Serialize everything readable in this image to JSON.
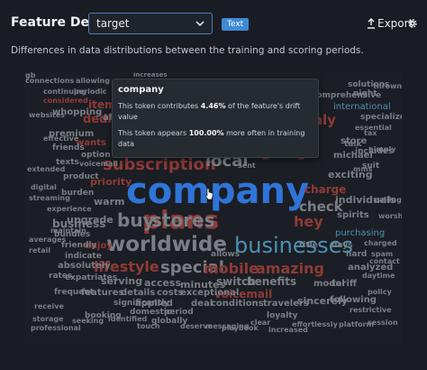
{
  "header": {
    "title": "Feature Details",
    "select_value": "target",
    "type_badge": "Text",
    "export_label": "Export",
    "description": "Differences in data distributions between the training and scoring periods."
  },
  "tooltip": {
    "word": "company",
    "line1_a": "This token contributes ",
    "line1_pct": "4.46%",
    "line1_b": " of the feature's drift value",
    "line2_a": "This token appears ",
    "line2_pct": "100.00%",
    "line2_b": " more often in training data"
  },
  "colors": {
    "accent": "#3f8ad6",
    "blue_word": "#2f74d8",
    "red_word": "#9c3a37",
    "teal_word": "#4c91b3",
    "grey_word": "#7a7f86"
  },
  "icons": {
    "select": "chevron-down-icon",
    "export": "upload-icon",
    "settings": "gear-icon"
  },
  "cloud_words": [
    {
      "t": "company",
      "c": "#2f74d8"
    },
    {
      "t": "plans",
      "c": "#8f3a37"
    },
    {
      "t": "businesses",
      "c": "#4c91b3"
    },
    {
      "t": "worldwide",
      "c": "#7a7f86"
    },
    {
      "t": "buy",
      "c": "#7a7f86"
    },
    {
      "t": "stores",
      "c": "#7a7f86"
    },
    {
      "t": "subscription",
      "c": "#8f3a37"
    },
    {
      "t": "local",
      "c": "#7a7f86"
    },
    {
      "t": "going",
      "c": "#8f3a37"
    },
    {
      "t": "lifestyle",
      "c": "#8f3a37"
    },
    {
      "t": "special",
      "c": "#7a7f86"
    },
    {
      "t": "mobile",
      "c": "#8f3a37"
    },
    {
      "t": "amazing",
      "c": "#8f3a37"
    },
    {
      "t": "hey",
      "c": "#8f3a37"
    },
    {
      "t": "check",
      "c": "#7a7f86"
    },
    {
      "t": "charge",
      "c": "#8f3a37"
    },
    {
      "t": "dedica",
      "c": "#8f3a37"
    },
    {
      "t": "athly",
      "c": "#8f3a37"
    },
    {
      "t": "priority",
      "c": "#8f3a37"
    },
    {
      "t": "warm",
      "c": "#7a7f86"
    },
    {
      "t": "business",
      "c": "#7a7f86"
    },
    {
      "t": "items",
      "c": "#8f3a37"
    },
    {
      "t": "upgrade",
      "c": "#7a7f86"
    },
    {
      "t": "switch",
      "c": "#7a7f86"
    },
    {
      "t": "benefits",
      "c": "#7a7f86"
    },
    {
      "t": "voicemail",
      "c": "#8f3a37"
    },
    {
      "t": "access",
      "c": "#7a7f86"
    },
    {
      "t": "minutes",
      "c": "#7a7f86"
    },
    {
      "t": "absolutely",
      "c": "#7a7f86"
    },
    {
      "t": "serving",
      "c": "#7a7f86"
    },
    {
      "t": "features",
      "c": "#7a7f86"
    },
    {
      "t": "details",
      "c": "#7a7f86"
    },
    {
      "t": "costs",
      "c": "#7a7f86"
    },
    {
      "t": "exceptional",
      "c": "#7a7f86"
    },
    {
      "t": "sincerely",
      "c": "#7a7f86"
    },
    {
      "t": "following",
      "c": "#7a7f86"
    },
    {
      "t": "model",
      "c": "#7a7f86"
    },
    {
      "t": "tariff",
      "c": "#7a7f86"
    },
    {
      "t": "purchasing",
      "c": "#4c91b3"
    },
    {
      "t": "analyzed",
      "c": "#7a7f86"
    },
    {
      "t": "store",
      "c": "#7a7f86"
    },
    {
      "t": "international",
      "c": "#4c91b3"
    },
    {
      "t": "exciting",
      "c": "#7a7f86"
    },
    {
      "t": "individuals",
      "c": "#7a7f86"
    },
    {
      "t": "spirits",
      "c": "#7a7f86"
    },
    {
      "t": "whopping",
      "c": "#7a7f86"
    },
    {
      "t": "premium",
      "c": "#7a7f86"
    },
    {
      "t": "affordable",
      "c": "#7a7f86"
    },
    {
      "t": "wants",
      "c": "#8f3a37"
    },
    {
      "t": "travelers",
      "c": "#7a7f86"
    },
    {
      "t": "loyalty",
      "c": "#7a7f86"
    },
    {
      "t": "applied",
      "c": "#7a7f86"
    },
    {
      "t": "deal",
      "c": "#7a7f86"
    },
    {
      "t": "conditions",
      "c": "#7a7f86"
    },
    {
      "t": "domestic",
      "c": "#7a7f86"
    },
    {
      "t": "period",
      "c": "#7a7f86"
    },
    {
      "t": "friends",
      "c": "#7a7f86"
    },
    {
      "t": "texts",
      "c": "#7a7f86"
    },
    {
      "t": "bundles",
      "c": "#7a7f86"
    },
    {
      "t": "enjoy",
      "c": "#8f3a37"
    },
    {
      "t": "friendly",
      "c": "#7a7f86"
    },
    {
      "t": "indicate",
      "c": "#7a7f86"
    },
    {
      "t": "rates",
      "c": "#7a7f86"
    },
    {
      "t": "frequent",
      "c": "#7a7f86"
    },
    {
      "t": "expatriates",
      "c": "#7a7f86"
    },
    {
      "t": "significantly",
      "c": "#7a7f86"
    },
    {
      "t": "booking",
      "c": "#7a7f86"
    },
    {
      "t": "globally",
      "c": "#7a7f86"
    },
    {
      "t": "messaging",
      "c": "#7a7f86"
    },
    {
      "t": "playbook",
      "c": "#7a7f86"
    },
    {
      "t": "effortlessly",
      "c": "#7a7f86"
    },
    {
      "t": "platform",
      "c": "#7a7f86"
    },
    {
      "t": "restrictive",
      "c": "#7a7f86"
    },
    {
      "t": "seeking",
      "c": "#7a7f86"
    },
    {
      "t": "identified",
      "c": "#7a7f86"
    },
    {
      "t": "professional",
      "c": "#7a7f86"
    },
    {
      "t": "touch",
      "c": "#7a7f86"
    },
    {
      "t": "deserve",
      "c": "#7a7f86"
    },
    {
      "t": "clear",
      "c": "#7a7f86"
    },
    {
      "t": "increased",
      "c": "#7a7f86"
    },
    {
      "t": "session",
      "c": "#7a7f86"
    },
    {
      "t": "connections",
      "c": "#7a7f86"
    },
    {
      "t": "continuing",
      "c": "#7a7f86"
    },
    {
      "t": "considered",
      "c": "#8f3a37"
    },
    {
      "t": "websites",
      "c": "#7a7f86"
    },
    {
      "t": "effective",
      "c": "#7a7f86"
    },
    {
      "t": "extended",
      "c": "#7a7f86"
    },
    {
      "t": "voicemail",
      "c": "#7a7f86"
    },
    {
      "t": "digital",
      "c": "#7a7f86"
    },
    {
      "t": "streaming",
      "c": "#7a7f86"
    },
    {
      "t": "experience",
      "c": "#7a7f86"
    },
    {
      "t": "maintain",
      "c": "#7a7f86"
    },
    {
      "t": "averages",
      "c": "#7a7f86"
    },
    {
      "t": "retail",
      "c": "#7a7f86"
    },
    {
      "t": "receive",
      "c": "#7a7f86"
    },
    {
      "t": "storage",
      "c": "#7a7f86"
    },
    {
      "t": "comprehensive",
      "c": "#7a7f86"
    },
    {
      "t": "solutions",
      "c": "#7a7f86"
    },
    {
      "t": "thrown",
      "c": "#7a7f86"
    },
    {
      "t": "specialize",
      "c": "#7a7f86"
    },
    {
      "t": "essential",
      "c": "#7a7f86"
    },
    {
      "t": "includes",
      "c": "#7a7f86"
    },
    {
      "t": "michael",
      "c": "#7a7f86"
    },
    {
      "t": "simply",
      "c": "#7a7f86"
    },
    {
      "t": "suit",
      "c": "#7a7f86"
    },
    {
      "t": "calling",
      "c": "#7a7f86"
    },
    {
      "t": "worship",
      "c": "#7a7f86"
    },
    {
      "t": "charged",
      "c": "#7a7f86"
    },
    {
      "t": "contact",
      "c": "#7a7f86"
    },
    {
      "t": "daytime",
      "c": "#7a7f86"
    },
    {
      "t": "policy",
      "c": "#7a7f86"
    },
    {
      "t": "product",
      "c": "#7a7f86"
    },
    {
      "t": "burden",
      "c": "#7a7f86"
    },
    {
      "t": "option",
      "c": "#7a7f86"
    },
    {
      "t": "title",
      "c": "#7a7f86"
    },
    {
      "t": "days",
      "c": "#7a7f86"
    },
    {
      "t": "hard",
      "c": "#7a7f86"
    },
    {
      "t": "spam",
      "c": "#7a7f86"
    },
    {
      "t": "allowing",
      "c": "#7a7f86"
    },
    {
      "t": "periodic",
      "c": "#7a7f86"
    },
    {
      "t": "increases",
      "c": "#7a7f86"
    },
    {
      "t": "night",
      "c": "#7a7f86"
    },
    {
      "t": "talk",
      "c": "#7a7f86"
    },
    {
      "t": "tax",
      "c": "#7a7f86"
    },
    {
      "t": "sent",
      "c": "#7a7f86"
    },
    {
      "t": "mms",
      "c": "#7a7f86"
    },
    {
      "t": "allows",
      "c": "#7a7f86"
    },
    {
      "t": "gb",
      "c": "#7a7f86"
    }
  ]
}
